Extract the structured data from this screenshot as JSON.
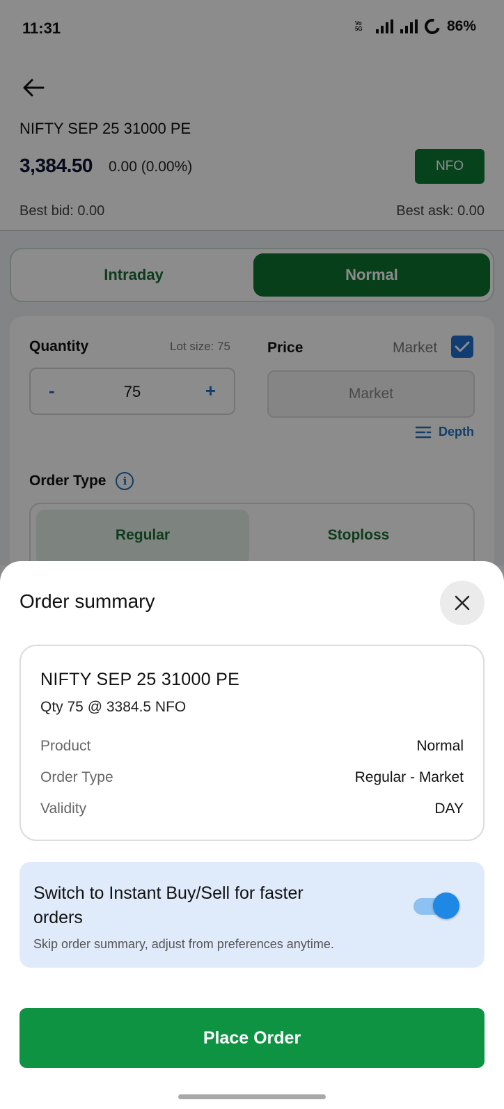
{
  "status_bar": {
    "time": "11:31",
    "volte": "Vo 5G",
    "network": "5G",
    "battery": "86%"
  },
  "header": {
    "contract": "NIFTY SEP 25 31000 PE",
    "ltp": "3,384.50",
    "change": "0.00 (0.00%)",
    "exchange": "NFO",
    "best_bid": "Best bid: 0.00",
    "best_ask": "Best ask: 0.00"
  },
  "product_tabs": {
    "intraday": "Intraday",
    "normal": "Normal",
    "selected": "Normal"
  },
  "form": {
    "quantity_label": "Quantity",
    "lot_size": "Lot size: 75",
    "quantity_value": "75",
    "minus": "-",
    "plus": "+",
    "price_label": "Price",
    "market_label": "Market",
    "market_checked": true,
    "price_placeholder": "Market",
    "depth_label": "Depth",
    "order_type_label": "Order Type",
    "order_types": [
      "Regular",
      "Stoploss"
    ],
    "selected_order_type": "Regular"
  },
  "sheet": {
    "title": "Order summary",
    "contract": "NIFTY SEP 25 31000 PE",
    "qty_line": "Qty 75 @ 3384.5 NFO",
    "rows": [
      {
        "key": "Product",
        "value": "Normal"
      },
      {
        "key": "Order Type",
        "value": "Regular - Market"
      },
      {
        "key": "Validity",
        "value": "DAY"
      }
    ],
    "instant_title": "Switch to Instant Buy/Sell for faster orders",
    "instant_subtitle": "Skip order summary, adjust from preferences anytime.",
    "instant_enabled": true,
    "place_order": "Place Order"
  },
  "colors": {
    "brand_green": "#0d9342",
    "accent_blue": "#1e88e5",
    "info_bg": "#dfeafb"
  }
}
